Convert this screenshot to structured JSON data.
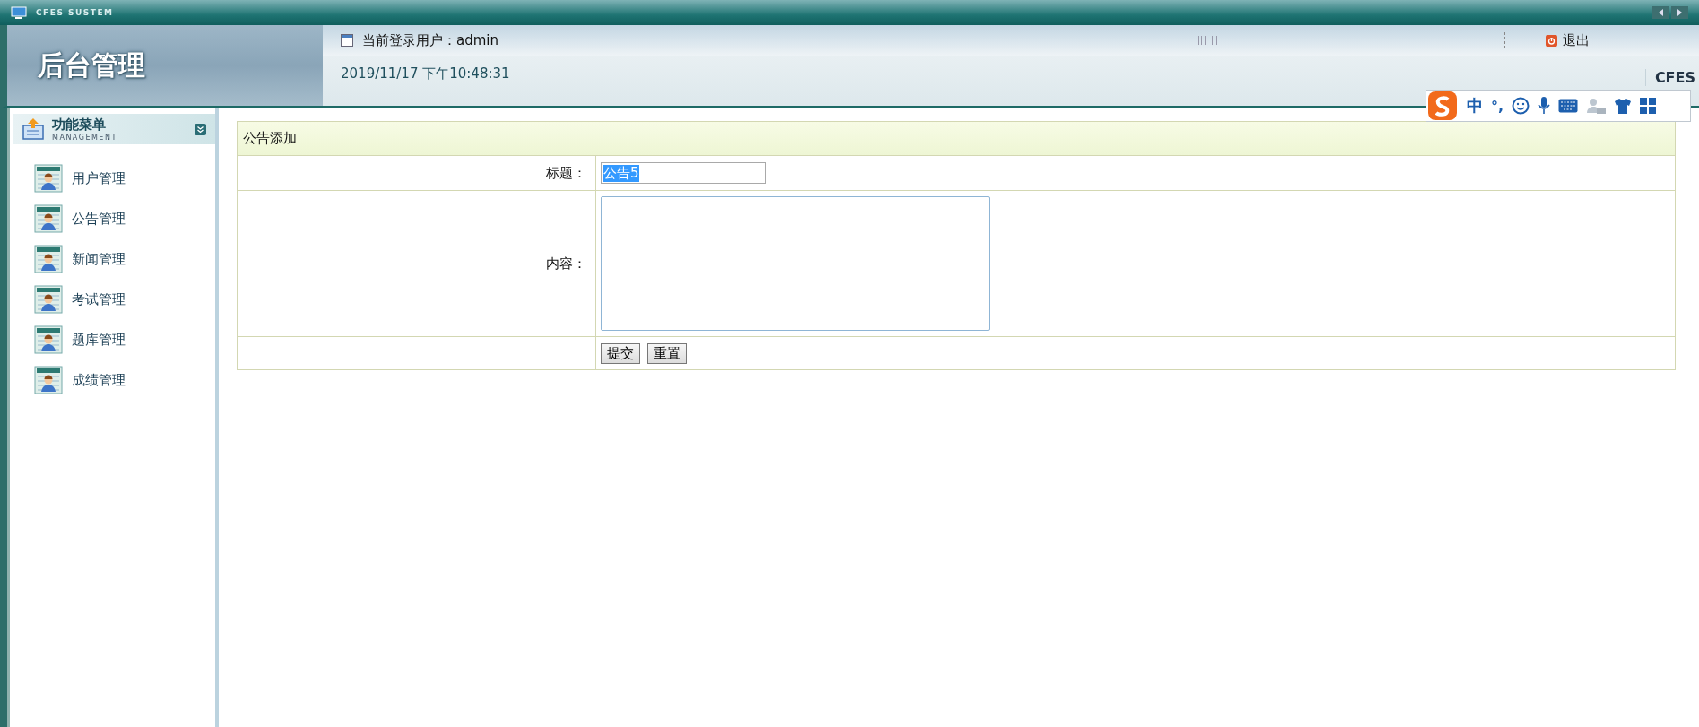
{
  "window": {
    "title": "CFES SUSTEM"
  },
  "header": {
    "logo": "后台管理",
    "user_label": "当前登录用户：admin",
    "datetime": "2019/11/17 下午10:48:31",
    "logout": "退出",
    "brand_cut": "CFES"
  },
  "ime_toolbar": {
    "mode": "中",
    "punct": "°,"
  },
  "sidebar": {
    "title": "功能菜单",
    "subtitle": "MANAGEMENT",
    "items": [
      {
        "label": "用户管理"
      },
      {
        "label": "公告管理"
      },
      {
        "label": "新闻管理"
      },
      {
        "label": "考试管理"
      },
      {
        "label": "题库管理"
      },
      {
        "label": "成绩管理"
      }
    ]
  },
  "form": {
    "title": "公告添加",
    "fields": [
      {
        "kind": "text",
        "label": "标题：",
        "value": "公告5",
        "value_selected": true
      },
      {
        "kind": "textarea",
        "label": "内容："
      }
    ],
    "buttons": [
      "提交",
      "重置"
    ]
  }
}
